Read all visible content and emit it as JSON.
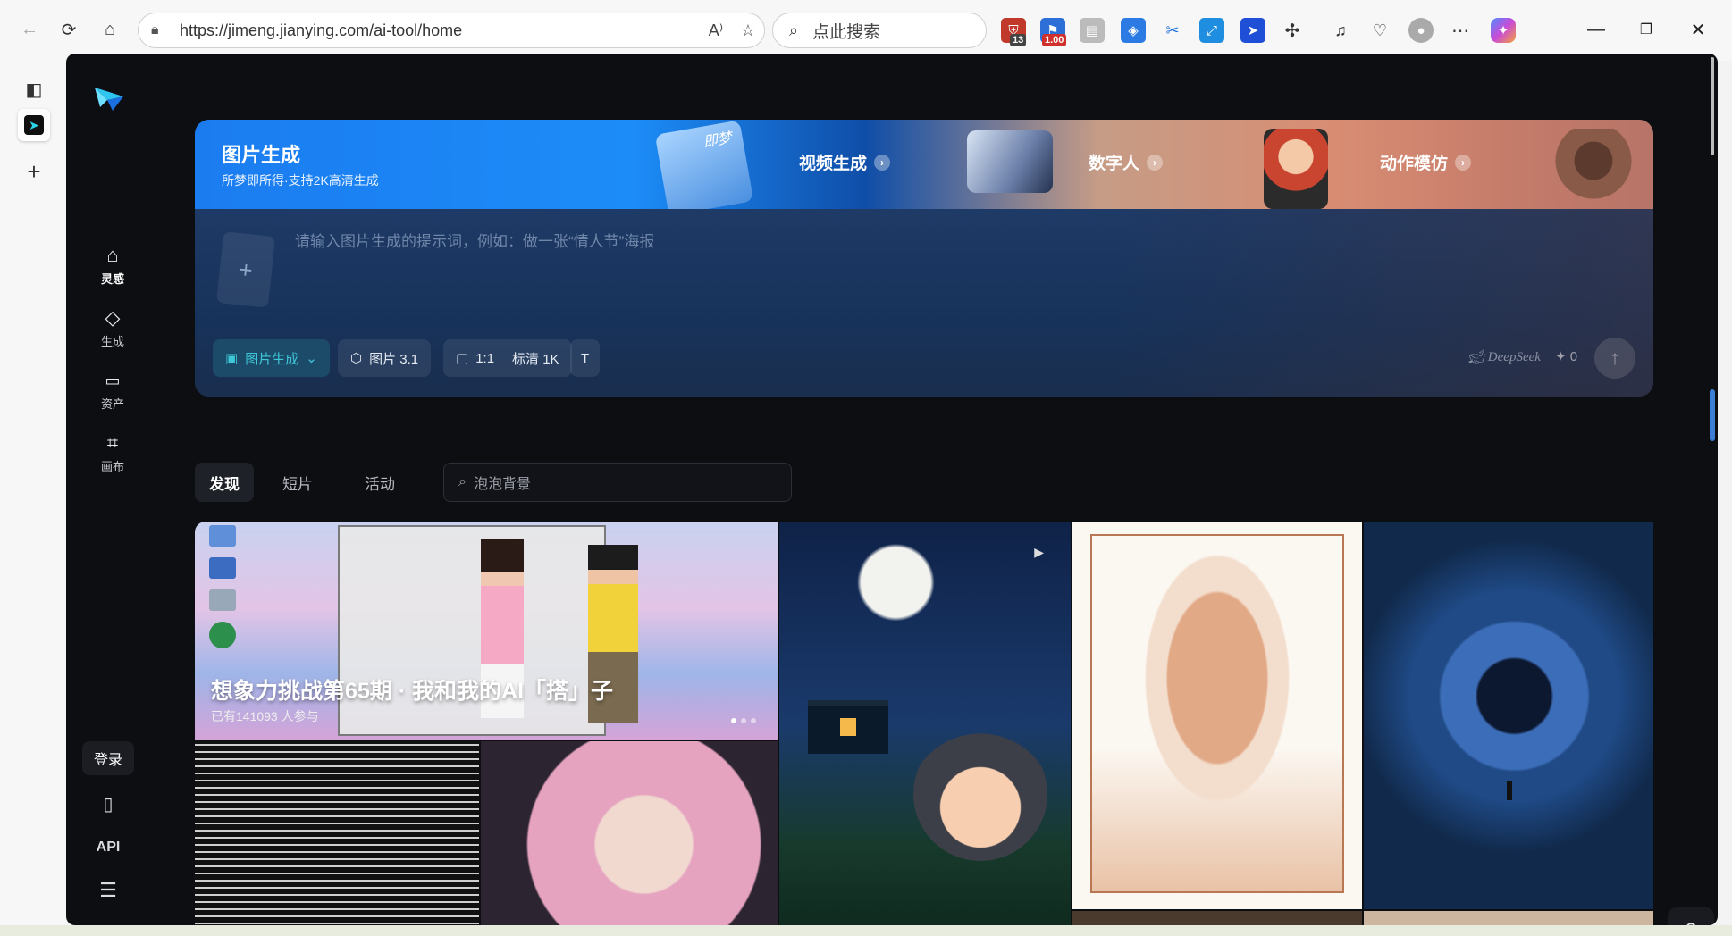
{
  "browser": {
    "url": "https://jimeng.jianying.com/ai-tool/home",
    "search_placeholder": "点此搜索",
    "ext_badges": {
      "a": "13",
      "b": "1.00"
    }
  },
  "sidebar": {
    "items": [
      {
        "label": "灵感",
        "icon": "home-icon"
      },
      {
        "label": "生成",
        "icon": "diamond-icon"
      },
      {
        "label": "资产",
        "icon": "folder-icon"
      },
      {
        "label": "画布",
        "icon": "canvas-icon"
      }
    ],
    "login_label": "登录",
    "api_label": "API"
  },
  "hero": {
    "title": "图片生成",
    "subtitle": "所梦即所得·支持2K高清生成",
    "features": [
      "视频生成",
      "数字人",
      "动作模仿"
    ],
    "watermark_text": "即梦",
    "prompt_placeholder": "请输入图片生成的提示词，例如：做一张“情人节”海报",
    "mode_label": "图片生成",
    "model_label": "图片 3.1",
    "ratio_label": "1:1",
    "quality_label": "标清 1K",
    "deepseek_label": "DeepSeek",
    "credits": "0"
  },
  "tabs": [
    "发现",
    "短片",
    "活动"
  ],
  "filter_search_value": "泡泡背景",
  "banner": {
    "title": "想象力挑战第65期 · 我和我的AI「搭」子",
    "subtitle": "已有141093 人参与"
  },
  "colors": {
    "app_bg": "#0d0e12",
    "accent_cyan": "#3ec7d6",
    "brand_blue": "#1c8cf8"
  }
}
